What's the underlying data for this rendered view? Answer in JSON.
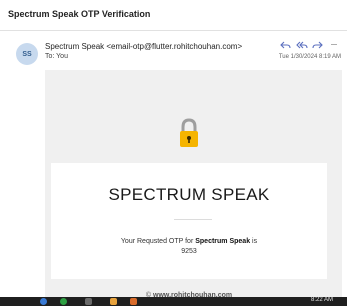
{
  "email": {
    "subject": "Spectrum Speak OTP Verification",
    "avatar_initials": "SS",
    "sender_line": "Spectrum Speak <email-otp@flutter.rohitchouhan.com>",
    "to_line": "To: You",
    "date": "Tue 1/30/2024 8:19 AM",
    "actions": {
      "reply_icon": "reply-icon",
      "reply_all_icon": "reply-all-icon",
      "forward_icon": "forward-icon",
      "more_icon": "more-icon",
      "more_label": "···"
    }
  },
  "body": {
    "lock_icon": "lock-icon",
    "brand": "SPECTRUM SPEAK",
    "otp_prefix": "Your Requsted OTP for ",
    "otp_app": "Spectrum Speak",
    "otp_suffix": " is",
    "otp_code": "9253",
    "footer_prefix": "© ",
    "footer_link": "www.rohitchouhan.com"
  },
  "taskbar": {
    "time": "8:22 AM"
  },
  "colors": {
    "accent": "#5b6fbf",
    "lock_body": "#f5b400",
    "mail_background": "#f0f0f0"
  }
}
